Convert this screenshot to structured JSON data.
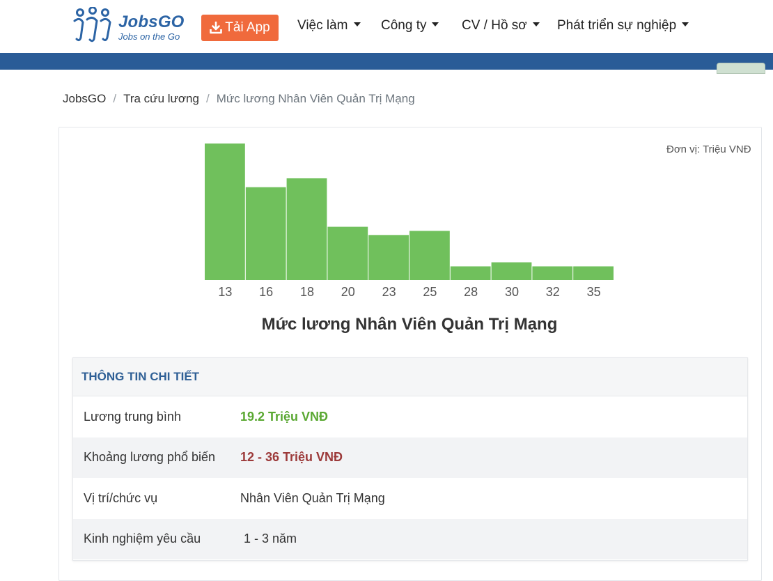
{
  "header": {
    "logo_name": "JobsGO",
    "logo_tagline": "Jobs on the Go",
    "app_button": "Tải App",
    "nav": [
      {
        "label": "Việc làm"
      },
      {
        "label": "Công ty"
      },
      {
        "label": "CV / Hồ sơ"
      },
      {
        "label": "Phát triển sự nghiệp"
      }
    ],
    "brand_color": "#2c64a5",
    "accent_color": "#f06a3c"
  },
  "breadcrumb": {
    "items": [
      "JobsGO",
      "Tra cứu lương"
    ],
    "current": "Mức lương Nhân Viên Quản Trị Mạng"
  },
  "chart_data": {
    "type": "bar",
    "categories": [
      "13",
      "16",
      "18",
      "20",
      "23",
      "25",
      "28",
      "30",
      "32",
      "35"
    ],
    "values": [
      1.0,
      0.68,
      0.745,
      0.39,
      0.33,
      0.36,
      0.1,
      0.13,
      0.1,
      0.1
    ],
    "unit_note": "Đơn vị: Triệu VNĐ",
    "title": "Mức lương Nhân Viên Quản Trị Mạng",
    "bar_color": "#70c05c",
    "ylim": [
      0,
      1.0
    ]
  },
  "details": {
    "heading": "THÔNG TIN CHI TIẾT",
    "rows": [
      {
        "label": "Lương trung bình",
        "value": "19.2 Triệu VNĐ"
      },
      {
        "label": "Khoảng lương phổ biến",
        "value": "12 - 36 Triệu VNĐ"
      },
      {
        "label": "Vị trí/chức vụ",
        "value": "Nhân Viên Quản Trị Mạng"
      },
      {
        "label": "Kinh nghiệm yêu cầu",
        "value": " 1 - 3 năm"
      }
    ]
  }
}
